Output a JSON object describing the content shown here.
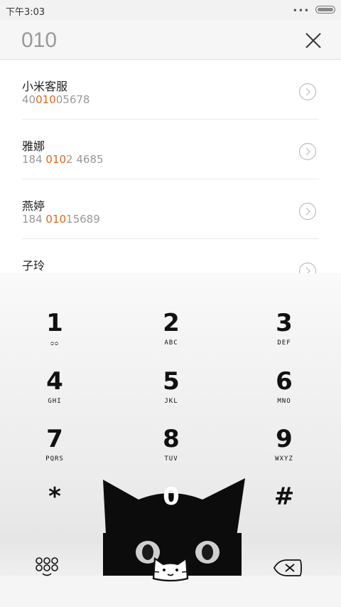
{
  "status_bar": {
    "time": "下午3:03",
    "dots": "•••"
  },
  "search": {
    "query": "010"
  },
  "results": [
    {
      "name": "小米客服",
      "number_pre": "40",
      "number_match": "010",
      "number_post": "05678"
    },
    {
      "name": "雅娜",
      "number_pre": "184 ",
      "number_match": "010",
      "number_post": "2 4685"
    },
    {
      "name": "燕婷",
      "number_pre": "184 ",
      "number_match": "010",
      "number_post": "15689"
    },
    {
      "name": "子玲",
      "number_pre": "",
      "number_match": "",
      "number_post": ""
    }
  ],
  "keypad": {
    "keys": [
      {
        "digit": "1",
        "letters": "ᴑᴑ"
      },
      {
        "digit": "2",
        "letters": "ABC"
      },
      {
        "digit": "3",
        "letters": "DEF"
      },
      {
        "digit": "4",
        "letters": "GHI"
      },
      {
        "digit": "5",
        "letters": "JKL"
      },
      {
        "digit": "6",
        "letters": "MNO"
      },
      {
        "digit": "7",
        "letters": "PQRS"
      },
      {
        "digit": "8",
        "letters": "TUV"
      },
      {
        "digit": "9",
        "letters": "WXYZ"
      },
      {
        "digit": "*",
        "letters": ""
      },
      {
        "digit": "0",
        "letters": ""
      },
      {
        "digit": "#",
        "letters": ""
      }
    ]
  },
  "colors": {
    "highlight": "#e4651a",
    "cat": "#0c0c0c"
  },
  "icons": [
    "clear-icon",
    "detail-arrow-icon",
    "dialpad-toggle-icon",
    "cat-call-icon",
    "delete-icon"
  ]
}
